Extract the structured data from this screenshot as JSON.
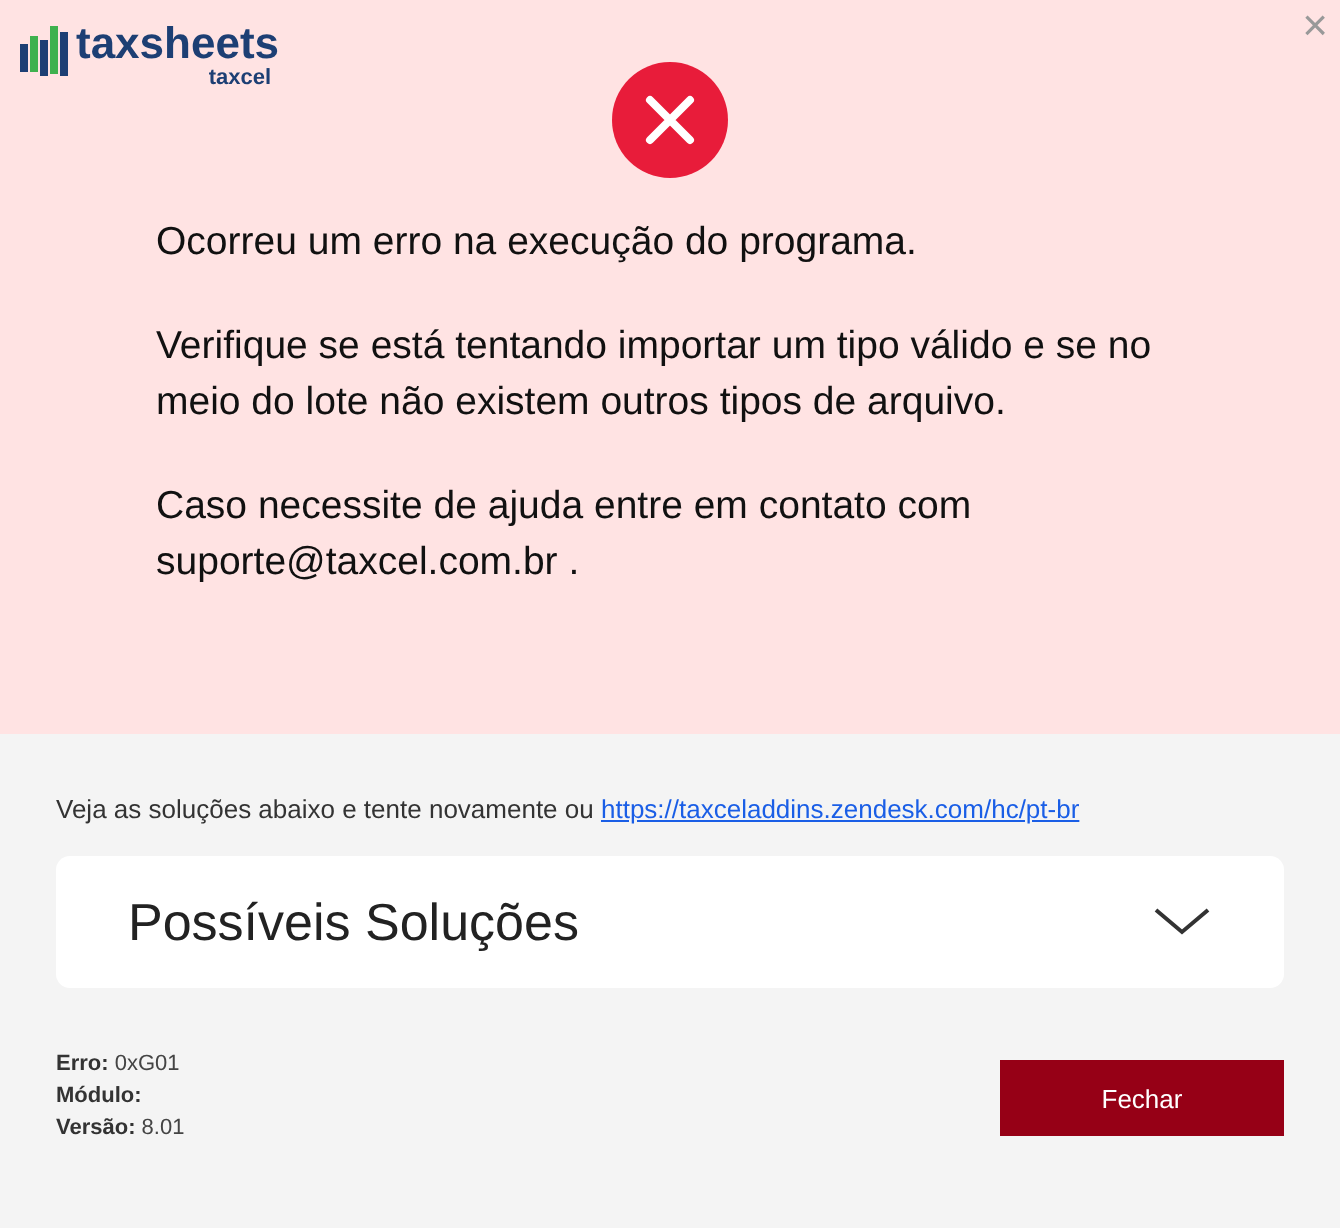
{
  "logo": {
    "name": "taxsheets",
    "sub": "taxcel"
  },
  "close": "×",
  "error": {
    "paragraphs": [
      "Ocorreu um erro na execução do programa.",
      "Verifique se está tentando importar um tipo válido e se no meio do lote não existem outros tipos de arquivo.",
      "Caso necessite de ajuda entre em contato com suporte@taxcel.com.br ."
    ]
  },
  "help": {
    "text": "Veja as soluções abaixo e tente novamente ou",
    "link": "https://taxceladdins.zendesk.com/hc/pt-br"
  },
  "accordion": {
    "title": "Possíveis Soluções",
    "expanded": false
  },
  "details": [
    "**Erro:** 0xG01",
    "**Módulo:**",
    "**Versão:** 8.01"
  ],
  "buttons": [
    "Fechar"
  ]
}
